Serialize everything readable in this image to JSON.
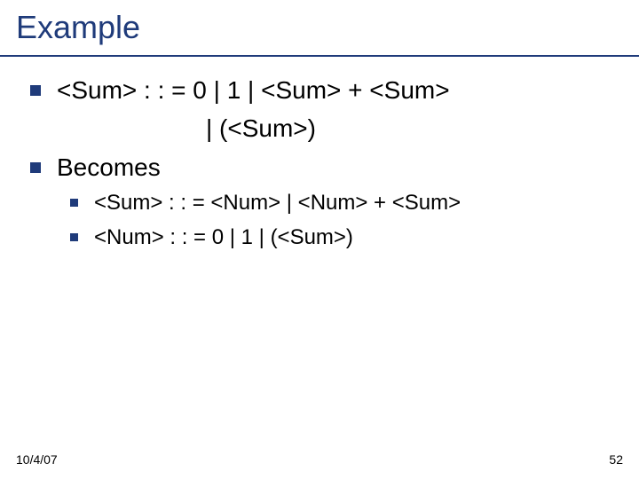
{
  "title": "Example",
  "lines": {
    "grammar_main": "<Sum> : : = 0 | 1 | <Sum> + <Sum>",
    "grammar_cont": "| (<Sum>)",
    "becomes": "Becomes",
    "sub1": "<Sum> : : = <Num> | <Num> + <Sum>",
    "sub2": "<Num> : : = 0 | 1 | (<Sum>)"
  },
  "footer": {
    "date": "10/4/07",
    "page": "52"
  }
}
